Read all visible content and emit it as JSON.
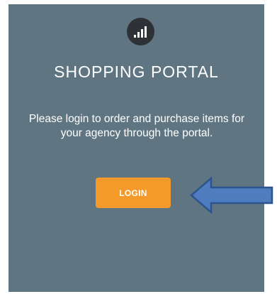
{
  "portal": {
    "logo_icon": "signal-bars-icon",
    "title": "SHOPPING PORTAL",
    "message": "Please login to order and purchase items for your agency through the portal.",
    "login_label": "LOGIN"
  },
  "annotation": {
    "arrow_icon": "left-arrow-icon",
    "arrow_color": "#4f7dc0"
  },
  "colors": {
    "panel_background": "#5f7682",
    "button_background": "#f39a2a",
    "logo_background": "#2e3236",
    "text": "#ffffff"
  }
}
